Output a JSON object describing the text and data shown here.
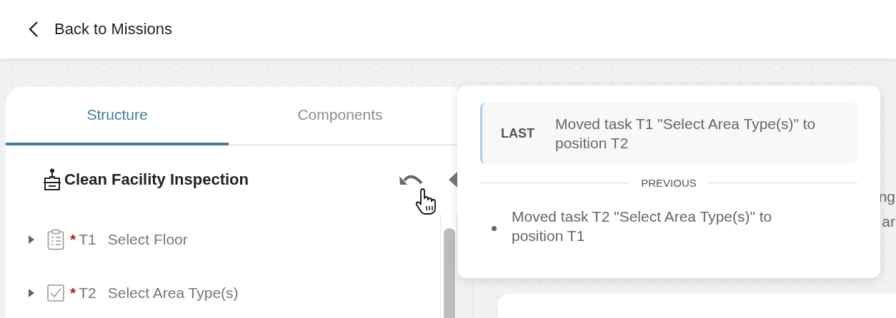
{
  "header": {
    "back_link": "Back to Missions"
  },
  "structure_panel": {
    "tabs": [
      {
        "label": "Structure",
        "selected": true
      },
      {
        "label": "Components",
        "selected": false
      }
    ],
    "title": "Clean Facility Inspection",
    "tasks": [
      {
        "kind": "list",
        "required_marker": "*",
        "id": "T1",
        "name": "Select Floor",
        "expanded": false
      },
      {
        "kind": "checkbox",
        "required_marker": "*",
        "id": "T2",
        "name": "Select Area Type(s)",
        "expanded": false
      }
    ]
  },
  "canvas": {
    "text_fragments": [
      "ng",
      "ar"
    ]
  },
  "history_popover": {
    "last": {
      "tag": "LAST",
      "text": "Moved task T1 \"Select Area Type(s)\" to position T2"
    },
    "divider": "PREVIOUS",
    "previous": [
      "Moved task T2 \"Select Area Type(s)\" to position T1"
    ]
  }
}
